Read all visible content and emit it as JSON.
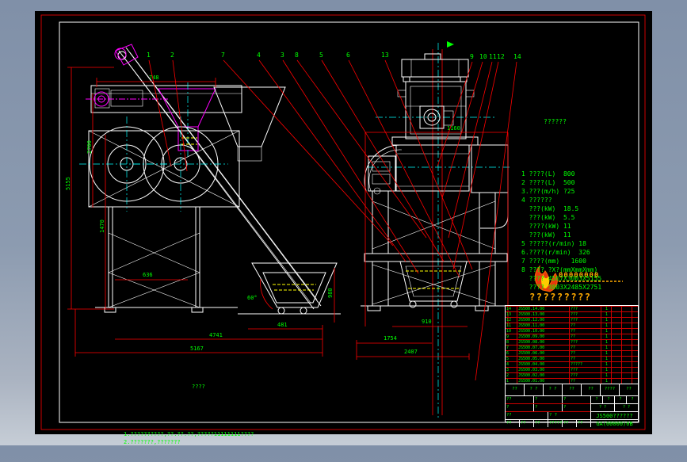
{
  "colors": {
    "canvas": "#000000",
    "frame_red": "#ff0000",
    "frame_white": "#ffffff",
    "dim_red": "#ff0000",
    "text_green": "#00ff00",
    "accent_magenta": "#ff00ff",
    "centerline_cyan": "#00ffff",
    "highlight_yellow": "#ffff00",
    "brand_orange": "#ffaa00",
    "flame_red": "#ff3300"
  },
  "balloons": [
    "1",
    "2",
    "7",
    "4",
    "3",
    "8",
    "5",
    "6",
    "13",
    "9",
    "10",
    "11",
    "12",
    "14"
  ],
  "dims": {
    "lv_top": "748",
    "lv_left_a": "5155",
    "lv_left_b": "2700",
    "lv_left_c": "1470",
    "lv_bot_a": "636",
    "lv_angle": "60°",
    "lv_bot_b": "481",
    "lv_bot_c": "4741",
    "lv_bot_d": "5167",
    "lv_right": "980",
    "rv_top": "1160",
    "rv_bot_a": "910",
    "rv_bot_b": "1754",
    "rv_bot_c": "2407"
  },
  "specs": {
    "title": "??????",
    "lines": [
      "1 ????(L)  800",
      "2 ????(L)  500",
      "3.???(m/h) ?25",
      "4 ??????",
      "  ???(kW)  18.5",
      "  ???(kW)  5.5",
      "  ????(kW) 11",
      "  ???(kW)  11",
      "5 ?????(r/min) 18",
      "6.????(r/min)  326",
      "7 ????(mm)   1600",
      "8 ???? ?X?(mmXmmXmm)",
      "  ???? 4567X3003X5155",
      "  ???? 3803X2485X2751"
    ]
  },
  "logo": {
    "brand": "00000000",
    "subtitle": "?????????"
  },
  "notes": {
    "title": "????",
    "lines": [
      "1.??????????,??.??.??,?????11111111????",
      "2.???????,???????"
    ]
  },
  "parts_list": {
    "rows": [
      {
        "no": "14",
        "code": "JS500.14.00",
        "name": "???",
        "qty": "1"
      },
      {
        "no": "13",
        "code": "JS500.13.00",
        "name": "???",
        "qty": "1"
      },
      {
        "no": "12",
        "code": "JS500.12.00",
        "name": "???",
        "qty": "1"
      },
      {
        "no": "11",
        "code": "JS500.11.00",
        "name": "??",
        "qty": "1"
      },
      {
        "no": "10",
        "code": "JS500.10.00",
        "name": "??",
        "qty": "1"
      },
      {
        "no": "9",
        "code": "JS500.09.00",
        "name": "??",
        "qty": "1"
      },
      {
        "no": "8",
        "code": "JS500.08.00",
        "name": "???",
        "qty": "1"
      },
      {
        "no": "7",
        "code": "JS500.07.00",
        "name": "??",
        "qty": "1"
      },
      {
        "no": "6",
        "code": "JS500.06.00",
        "name": "??",
        "qty": "1"
      },
      {
        "no": "5",
        "code": "JS500.05.00",
        "name": "??",
        "qty": "1"
      },
      {
        "no": "4",
        "code": "JS500.04.00",
        "name": "?????",
        "qty": "1"
      },
      {
        "no": "3",
        "code": "JS500.03.00",
        "name": "???",
        "qty": "1"
      },
      {
        "no": "2",
        "code": "JS500.02.00",
        "name": "???",
        "qty": "1"
      },
      {
        "no": "1",
        "code": "JS500.01.00",
        "name": "??",
        "qty": "1"
      }
    ]
  },
  "bom_header": [
    "??",
    "? ?",
    "? ?",
    "??",
    "??",
    "????",
    "??"
  ],
  "title_block": {
    "sig_row1": [
      "??",
      "?",
      "?"
    ],
    "sig_row2": [
      "?",
      "?",
      "?"
    ],
    "sig_row3": [
      "??",
      "? ?"
    ],
    "bottom_cells": [
      "??",
      "??",
      "??",
      "?????",
      "??",
      "??"
    ],
    "stage_cells": [
      "?",
      "?",
      "?",
      "?"
    ],
    "scale_cells": [
      "? ?",
      "? ?"
    ],
    "name": "JS500??????",
    "number": "GA(00000)0B"
  }
}
